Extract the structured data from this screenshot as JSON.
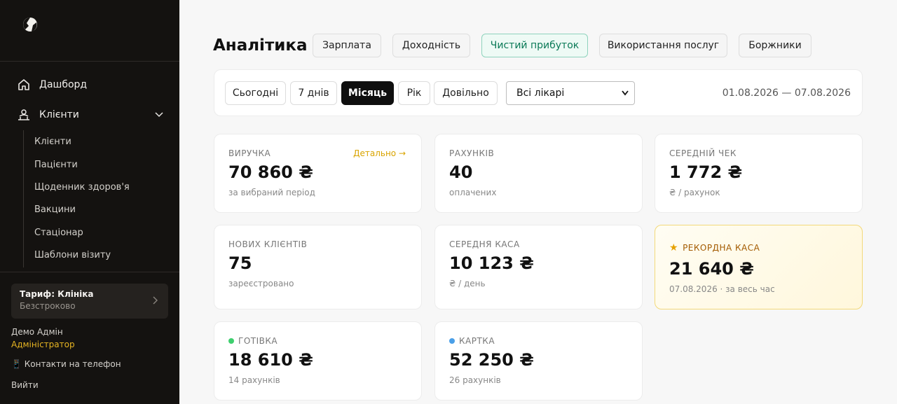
{
  "sidebar": {
    "nav": {
      "dashboard": "Дашборд",
      "clients": "Клієнти"
    },
    "sub_items": [
      "Клієнти",
      "Пацієнти",
      "Щоденник здоров'я",
      "Вакцини",
      "Стаціонар",
      "Шаблони візиту"
    ],
    "plan": {
      "title": "Тариф: Клініка",
      "subtitle": "Безстроково"
    },
    "user": {
      "name": "Демо Адмін",
      "role": "Адміністратор"
    },
    "contacts": "📱 Контакти на телефон",
    "logout": "Вийти"
  },
  "header": {
    "title": "Аналітика",
    "tabs": [
      "Зарплата",
      "Доходність",
      "Чистий прибуток",
      "Використання послуг",
      "Боржники"
    ],
    "active_tab": "Чистий прибуток"
  },
  "filters": {
    "periods": [
      "Сьогодні",
      "7 днів",
      "Місяць",
      "Рік",
      "Довільно"
    ],
    "active_period": "Місяць",
    "doctor_select": "Всі лікарі",
    "date_range": "01.08.2026 — 07.08.2026"
  },
  "cards": {
    "revenue": {
      "label": "ВИРУЧКА",
      "value": "70 860 ₴",
      "sub": "за вибраний період",
      "link": "Детально →"
    },
    "invoices": {
      "label": "РАХУНКІВ",
      "value": "40",
      "sub": "оплачених"
    },
    "avg_check": {
      "label": "СЕРЕДНІЙ ЧЕК",
      "value": "1 772 ₴",
      "sub": "₴ / рахунок"
    },
    "new_clients": {
      "label": "НОВИХ КЛІЄНТІВ",
      "value": "75",
      "sub": "зареєстровано"
    },
    "avg_cash": {
      "label": "СЕРЕДНЯ КАСА",
      "value": "10 123 ₴",
      "sub": "₴ / день"
    },
    "record_cash": {
      "label": "РЕКОРДНА КАСА",
      "value": "21 640 ₴",
      "sub": "07.08.2026 · за весь час"
    },
    "cash": {
      "label": "ГОТІВКА",
      "value": "18 610 ₴",
      "sub": "14 рахунків"
    },
    "card": {
      "label": "КАРТКА",
      "value": "52 250 ₴",
      "sub": "26 рахунків"
    }
  },
  "colors": {
    "accent": "#e6b422",
    "cash_dot": "#3ecf6e",
    "card_dot": "#4a9fe8",
    "active_tab": "#0b7a57"
  }
}
